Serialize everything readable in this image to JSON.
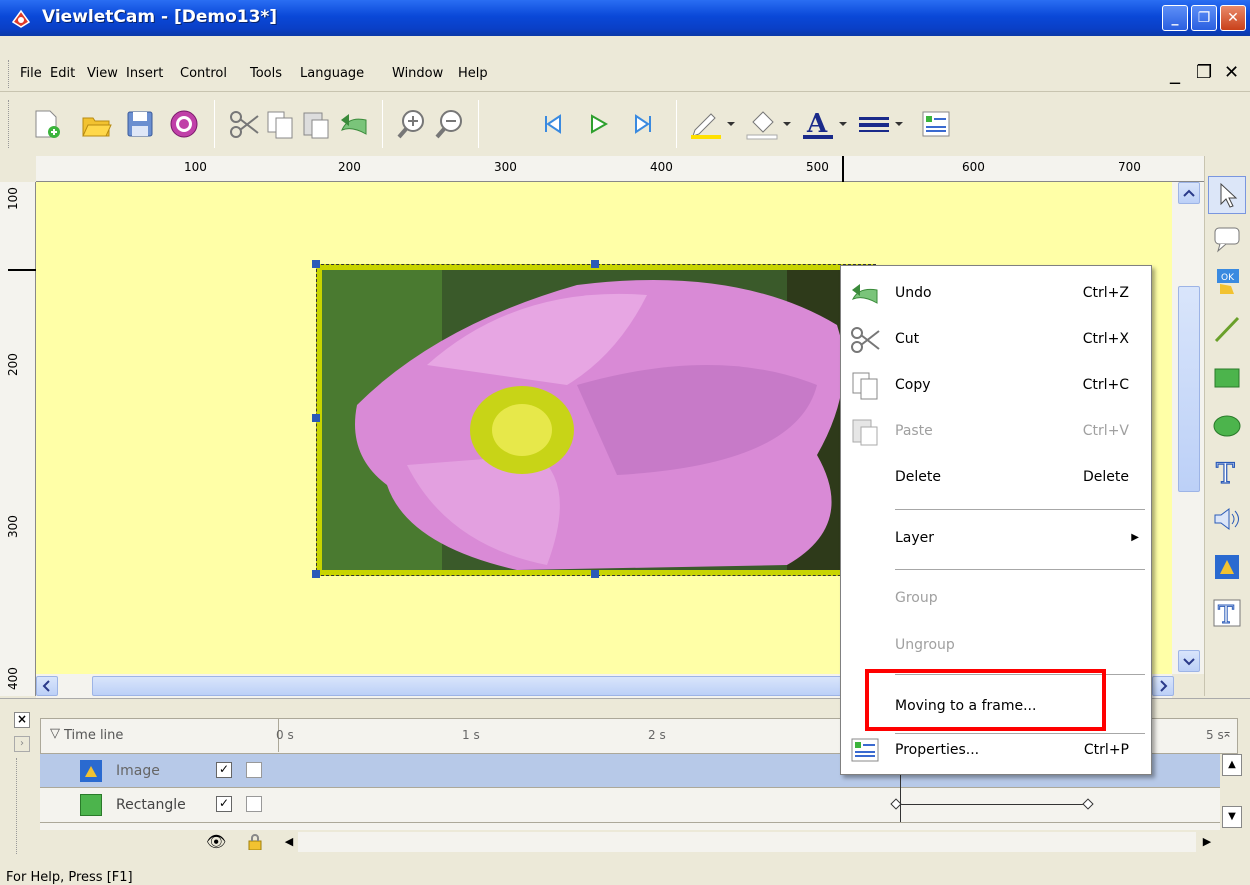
{
  "window": {
    "title": "ViewletCam - [Demo13*]",
    "controls": {
      "minimize": "_",
      "maximize": "❐",
      "close": "✕"
    }
  },
  "menubar": {
    "items": [
      "File",
      "Edit",
      "View",
      "Insert",
      "Control",
      "Tools",
      "Language",
      "Window",
      "Help"
    ],
    "mdi_controls": {
      "minimize": "_",
      "restore": "❐",
      "close": "✕"
    }
  },
  "toolbar": {
    "buttons": [
      "new-icon",
      "open-icon",
      "save-icon",
      "record-icon",
      "cut-icon",
      "copy-icon",
      "paste-icon",
      "undo-icon",
      "zoom-in-icon",
      "zoom-out-icon",
      "first-frame-icon",
      "play-icon",
      "last-frame-icon",
      "line-color-icon",
      "fill-color-icon",
      "font-color-icon",
      "line-style-icon",
      "properties-icon"
    ]
  },
  "ruler": {
    "horizontal": [
      "100",
      "200",
      "300",
      "400",
      "500",
      "600",
      "700"
    ],
    "vertical": [
      "100",
      "200",
      "300",
      "400"
    ]
  },
  "context_menu": {
    "items": [
      {
        "label": "Undo",
        "shortcut": "Ctrl+Z",
        "enabled": true
      },
      {
        "label": "Cut",
        "shortcut": "Ctrl+X",
        "enabled": true
      },
      {
        "label": "Copy",
        "shortcut": "Ctrl+C",
        "enabled": true
      },
      {
        "label": "Paste",
        "shortcut": "Ctrl+V",
        "enabled": false
      },
      {
        "label": "Delete",
        "shortcut": "Delete",
        "enabled": true
      },
      {
        "label": "Layer",
        "shortcut": "",
        "enabled": true
      },
      {
        "label": "Group",
        "shortcut": "",
        "enabled": false
      },
      {
        "label": "Ungroup",
        "shortcut": "",
        "enabled": false
      },
      {
        "label": "Moving to a frame...",
        "shortcut": "",
        "enabled": true
      },
      {
        "label": "Properties...",
        "shortcut": "Ctrl+P",
        "enabled": true
      }
    ],
    "highlight_color": "#ff0000"
  },
  "timeline": {
    "header": "Time line",
    "ticks": [
      "0 s",
      "1 s",
      "2 s",
      "5 s"
    ],
    "layers": [
      {
        "name": "Image",
        "visible": true,
        "locked": false,
        "selected": true
      },
      {
        "name": "Rectangle",
        "visible": true,
        "locked": false,
        "selected": false
      }
    ]
  },
  "palette": {
    "tools": [
      "pointer-icon",
      "callout-icon",
      "button-icon",
      "line-icon",
      "rectangle-icon",
      "ellipse-icon",
      "text-icon",
      "sound-icon",
      "image-icon",
      "text-box-icon"
    ]
  },
  "status": {
    "text": "For Help, Press [F1]"
  },
  "colors": {
    "canvas": "#ffffa7",
    "title_bar": "#0a48d8",
    "selection_row": "#b7c9e8"
  }
}
